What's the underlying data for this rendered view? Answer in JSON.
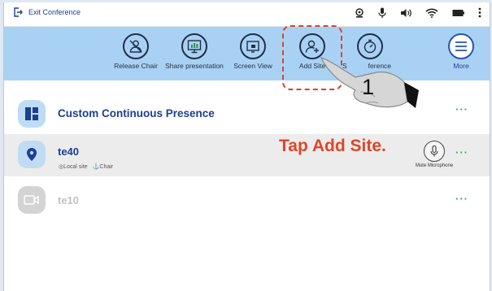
{
  "topbar": {
    "exit_label": "Exit Conference",
    "status_icons": [
      "camera-icon",
      "microphone-icon",
      "speaker-icon",
      "wifi-icon",
      "battery-icon",
      "more-vertical-icon"
    ]
  },
  "toolbar": {
    "buttons": [
      {
        "label": "Release Chair",
        "icon": "release-chair-icon"
      },
      {
        "label": "Share presentation",
        "icon": "share-presentation-icon"
      },
      {
        "label": "Screen View",
        "icon": "screen-view-icon"
      },
      {
        "label": "Add Site",
        "icon": "add-site-icon"
      },
      {
        "label": "S",
        "icon": "timer-icon"
      },
      {
        "label": "More",
        "icon": "menu-icon"
      }
    ],
    "partial_label_tail": "ference"
  },
  "list": {
    "presence": {
      "title": "Custom Continuous Presence",
      "icon": "layout-icon"
    },
    "sites": [
      {
        "name": "te40",
        "icon": "location-pin-icon",
        "tags": [
          "Local site",
          "Chair"
        ],
        "action_label": "Mute Microphone"
      },
      {
        "name": "te10",
        "icon": "video-camera-icon"
      }
    ],
    "more_glyph": "···"
  },
  "annotation": {
    "step_number": "1",
    "instruction": "Tap Add Site."
  },
  "colors": {
    "toolbar_bg": "#a9d1f3",
    "accent_blue": "#1b3f92",
    "highlight_red": "#e0452a",
    "more_green": "#2fb34a"
  }
}
